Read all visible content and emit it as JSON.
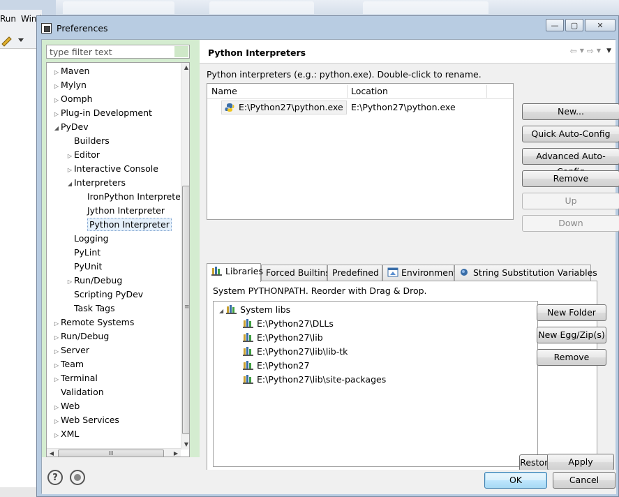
{
  "background": {
    "menu_items": [
      "Run",
      "Wind"
    ],
    "tab_count": 3
  },
  "window": {
    "title": "Preferences",
    "minimize_glyph": "—",
    "maximize_glyph": "▢",
    "close_glyph": "✕"
  },
  "filter": {
    "placeholder": "type filter text"
  },
  "tree": {
    "items": [
      {
        "label": "Maven",
        "level": 0,
        "arrow": "▷"
      },
      {
        "label": "Mylyn",
        "level": 0,
        "arrow": "▷"
      },
      {
        "label": "Oomph",
        "level": 0,
        "arrow": "▷"
      },
      {
        "label": "Plug-in Development",
        "level": 0,
        "arrow": "▷"
      },
      {
        "label": "PyDev",
        "level": 0,
        "arrow": "◢"
      },
      {
        "label": "Builders",
        "level": 1,
        "arrow": ""
      },
      {
        "label": "Editor",
        "level": 1,
        "arrow": "▷"
      },
      {
        "label": "Interactive Console",
        "level": 1,
        "arrow": "▷"
      },
      {
        "label": "Interpreters",
        "level": 1,
        "arrow": "◢"
      },
      {
        "label": "IronPython Interpreter",
        "level": 2,
        "arrow": ""
      },
      {
        "label": "Jython Interpreter",
        "level": 2,
        "arrow": ""
      },
      {
        "label": "Python Interpreter",
        "level": 2,
        "arrow": "",
        "selected": true
      },
      {
        "label": "Logging",
        "level": 1,
        "arrow": ""
      },
      {
        "label": "PyLint",
        "level": 1,
        "arrow": ""
      },
      {
        "label": "PyUnit",
        "level": 1,
        "arrow": ""
      },
      {
        "label": "Run/Debug",
        "level": 1,
        "arrow": "▷"
      },
      {
        "label": "Scripting PyDev",
        "level": 1,
        "arrow": ""
      },
      {
        "label": "Task Tags",
        "level": 1,
        "arrow": ""
      },
      {
        "label": "Remote Systems",
        "level": 0,
        "arrow": "▷"
      },
      {
        "label": "Run/Debug",
        "level": 0,
        "arrow": "▷"
      },
      {
        "label": "Server",
        "level": 0,
        "arrow": "▷"
      },
      {
        "label": "Team",
        "level": 0,
        "arrow": "▷"
      },
      {
        "label": "Terminal",
        "level": 0,
        "arrow": "▷"
      },
      {
        "label": "Validation",
        "level": 0,
        "arrow": ""
      },
      {
        "label": "Web",
        "level": 0,
        "arrow": "▷"
      },
      {
        "label": "Web Services",
        "level": 0,
        "arrow": "▷"
      },
      {
        "label": "XML",
        "level": 0,
        "arrow": "▷"
      }
    ],
    "hscroll_grip": "III"
  },
  "page": {
    "title": "Python Interpreters",
    "description": "Python interpreters (e.g.: python.exe).   Double-click to rename.",
    "nav": {
      "back": "⇦",
      "back_menu": "▼",
      "forward": "⇨",
      "forward_menu": "▼",
      "view_menu": "▼"
    }
  },
  "interpreters": {
    "columns": [
      "Name",
      "Location"
    ],
    "rows": [
      {
        "name": "E:\\Python27\\python.exe",
        "location": "E:\\Python27\\python.exe"
      }
    ]
  },
  "interpreter_buttons": {
    "new": "New...",
    "quick": "Quick Auto-Config",
    "advanced": "Advanced Auto-Config",
    "remove": "Remove",
    "up": "Up",
    "down": "Down"
  },
  "tabs": [
    {
      "label": "Libraries",
      "active": true
    },
    {
      "label": "Forced Builtins"
    },
    {
      "label": "Predefined"
    },
    {
      "label": "Environment"
    },
    {
      "label": "String Substitution Variables"
    }
  ],
  "libraries": {
    "description": "System PYTHONPATH.   Reorder with Drag & Drop.",
    "root": "System libs",
    "paths": [
      "E:\\Python27\\DLLs",
      "E:\\Python27\\lib",
      "E:\\Python27\\lib\\lib-tk",
      "E:\\Python27",
      "E:\\Python27\\lib\\site-packages"
    ]
  },
  "library_buttons": {
    "new_folder": "New Folder",
    "new_egg": "New Egg/Zip(s)",
    "remove": "Remove"
  },
  "footer": {
    "restore_defaults": "Restore Defaults",
    "apply": "Apply",
    "ok": "OK",
    "cancel": "Cancel",
    "help_glyph": "?"
  },
  "colors": {
    "selection": "#e5f0fb",
    "filter_panel": "#d4ecd0",
    "frame": "#b8cce2",
    "default_button": "#bee6fd"
  }
}
